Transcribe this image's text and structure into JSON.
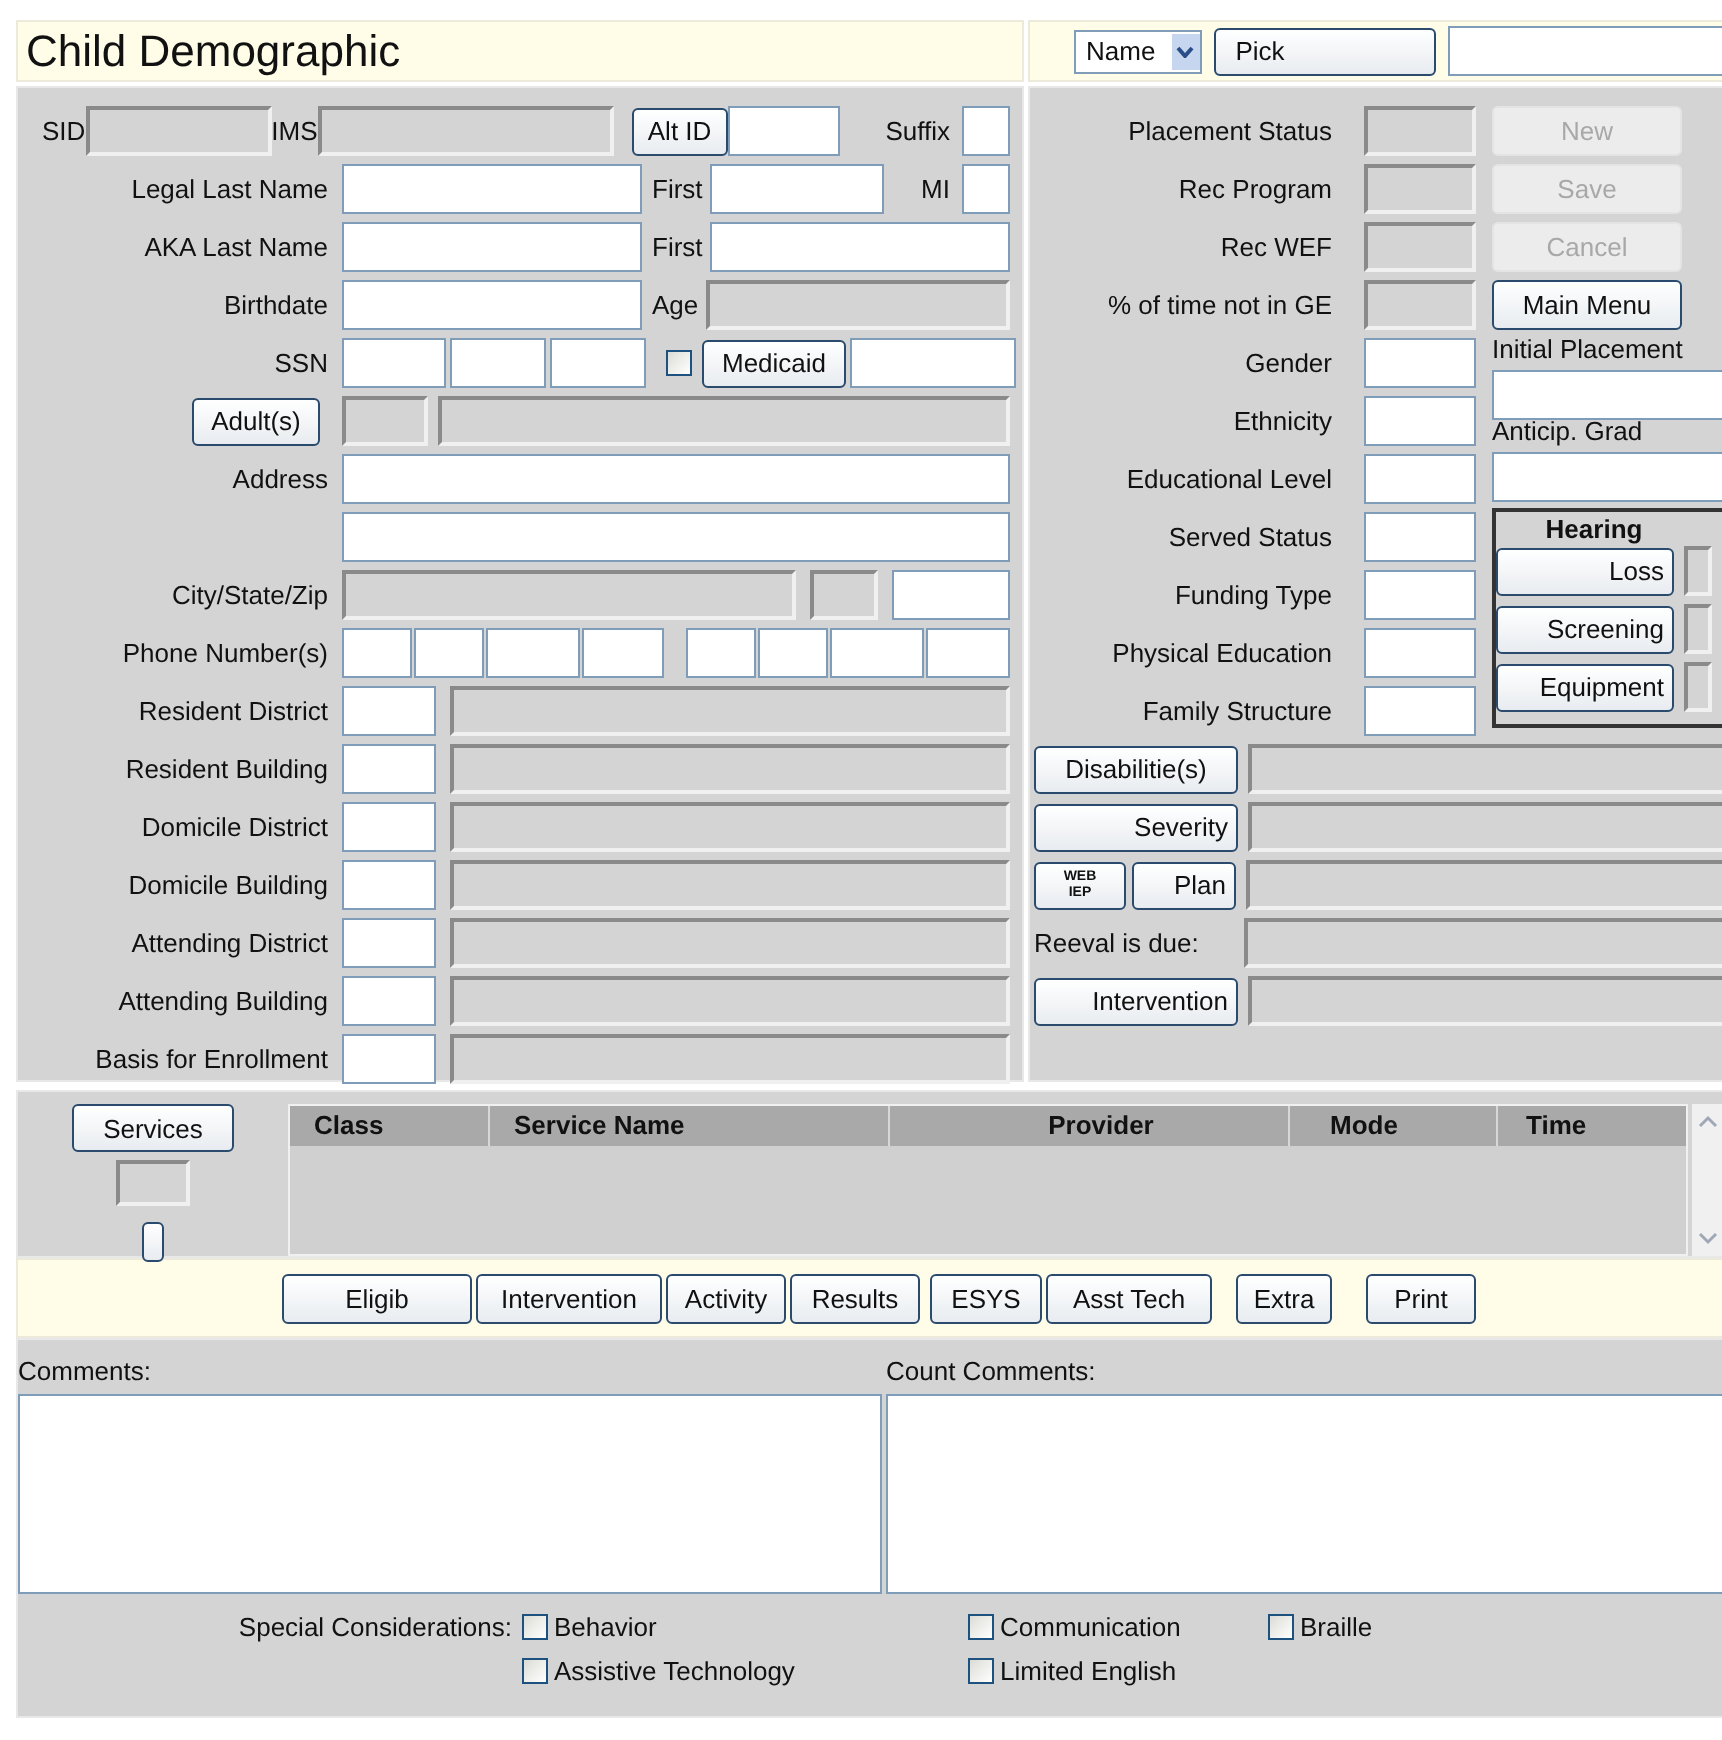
{
  "header": {
    "title": "Child Demographic",
    "lookup_field": "Name",
    "pick_button": "Pick"
  },
  "identity": {
    "sid": "SID",
    "ims": "IMS",
    "alt_id": "Alt ID",
    "suffix": "Suffix",
    "legal_last": "Legal Last Name",
    "legal_first": "First",
    "mi": "MI",
    "aka_last": "AKA Last Name",
    "aka_first": "First",
    "birthdate": "Birthdate",
    "age": "Age",
    "ssn": "SSN",
    "medicaid": {
      "label": "Medicaid",
      "checked": false
    },
    "adults": "Adult(s)",
    "address": "Address",
    "city": "City/State/Zip",
    "phone": "Phone Number(s)"
  },
  "districts": [
    "Resident District",
    "Resident Building",
    "Domicile District",
    "Domicile Building",
    "Attending District",
    "Attending Building",
    "Basis for Enrollment"
  ],
  "status_fields": [
    {
      "label": "Placement Status",
      "readonly": true
    },
    {
      "label": "Rec Program",
      "readonly": true
    },
    {
      "label": "Rec WEF",
      "readonly": true
    },
    {
      "label": "% of time not in GE",
      "readonly": true
    },
    {
      "label": "Gender",
      "readonly": false
    },
    {
      "label": "Ethnicity",
      "readonly": false
    },
    {
      "label": "Educational Level",
      "readonly": false
    },
    {
      "label": "Served Status",
      "readonly": false
    },
    {
      "label": "Funding Type",
      "readonly": false
    },
    {
      "label": "Physical Education",
      "readonly": false
    },
    {
      "label": "Family Structure",
      "readonly": false
    }
  ],
  "actions": [
    {
      "label": "New",
      "disabled": true
    },
    {
      "label": "Save",
      "disabled": true
    },
    {
      "label": "Cancel",
      "disabled": true
    },
    {
      "label": "Main Menu",
      "disabled": false
    }
  ],
  "initial_placement": "Initial Placement",
  "anticip_grad": "Anticip. Grad",
  "hearing": {
    "title": "Hearing",
    "buttons": [
      "Loss",
      "Screening",
      "Equipment"
    ]
  },
  "program": {
    "disabilities": "Disabilitie(s)",
    "severity": "Severity",
    "web_iep": [
      "WEB",
      "IEP"
    ],
    "plan": "Plan",
    "reeval": "Reeval is due:",
    "intervention": "Intervention"
  },
  "services": {
    "button": "Services",
    "columns": [
      "Class",
      "Service Name",
      "Provider",
      "Mode",
      "Time"
    ]
  },
  "toolbar": [
    "Eligib",
    "Intervention",
    "Activity",
    "Results",
    "ESYS",
    "Asst Tech",
    "Extra",
    "Print"
  ],
  "comments": {
    "comments_label": "Comments:",
    "count_label": "Count Comments:"
  },
  "special": {
    "label": "Special Considerations:",
    "options": [
      {
        "label": "Behavior",
        "checked": false
      },
      {
        "label": "Communication",
        "checked": false
      },
      {
        "label": "Braille",
        "checked": false
      },
      {
        "label": "Assistive Technology",
        "checked": false
      },
      {
        "label": "Limited English",
        "checked": false
      }
    ]
  }
}
